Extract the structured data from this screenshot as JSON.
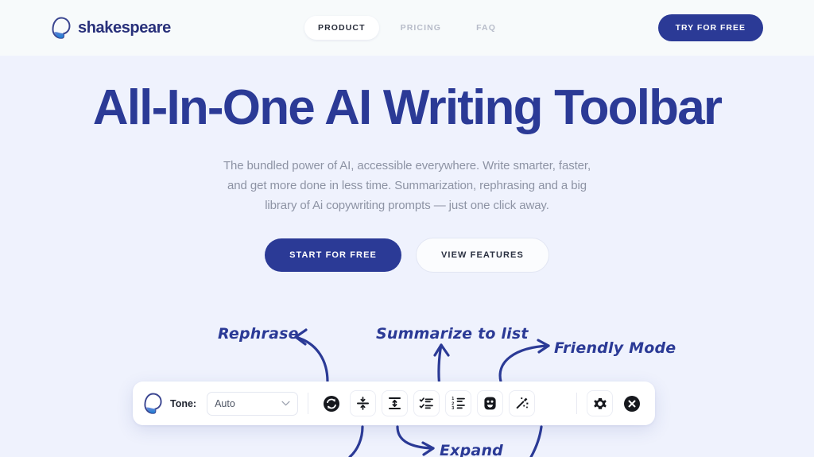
{
  "brand": {
    "name": "shakespeare",
    "logo_icon": "shakespeare-logo-icon"
  },
  "header": {
    "nav": [
      {
        "label": "PRODUCT",
        "active": true
      },
      {
        "label": "PRICING",
        "active": false
      },
      {
        "label": "FAQ",
        "active": false
      }
    ],
    "cta_label": "TRY FOR FREE"
  },
  "hero": {
    "headline": "All-In-One AI Writing Toolbar",
    "subtitle_lines": [
      "The bundled power of AI, accessible everywhere. Write smarter, faster,",
      "and get more done in less time. Summarization, rephrasing and a big",
      "library of Ai copywriting prompts — just one click away."
    ],
    "primary_cta": "START FOR FREE",
    "secondary_cta": "VIEW FEATURES"
  },
  "annotations": [
    {
      "id": "rephrase",
      "label": "Rephrase"
    },
    {
      "id": "summarize",
      "label": "Summarize to list"
    },
    {
      "id": "friendly",
      "label": "Friendly Mode"
    },
    {
      "id": "expand",
      "label": "Expand"
    }
  ],
  "toolbar": {
    "tone_label": "Tone:",
    "tone_value": "Auto",
    "buttons": [
      {
        "name": "rephrase-button",
        "icon": "refresh-circle-icon"
      },
      {
        "name": "shorten-button",
        "icon": "shorten-arrows-icon"
      },
      {
        "name": "expand-button",
        "icon": "expand-arrows-icon"
      },
      {
        "name": "checklist-button",
        "icon": "checklist-icon"
      },
      {
        "name": "numbered-list-button",
        "icon": "numbered-list-icon"
      },
      {
        "name": "friendly-mode-button",
        "icon": "smiley-icon"
      },
      {
        "name": "magic-wand-button",
        "icon": "magic-wand-icon"
      },
      {
        "name": "settings-button",
        "icon": "gear-icon"
      },
      {
        "name": "close-button",
        "icon": "close-circle-icon"
      }
    ]
  },
  "colors": {
    "brand_navy": "#2b3a96",
    "page_background": "#eff2fd",
    "header_background": "#f7fafb",
    "muted_text": "#8d93a4",
    "icon_dark": "#16181d"
  }
}
